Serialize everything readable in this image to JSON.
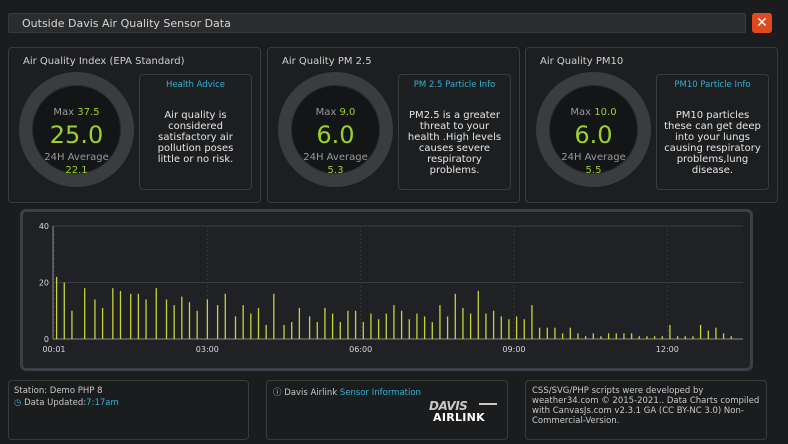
{
  "window": {
    "title": "Outside Davis Air Quality Sensor Data",
    "close_label": "✕"
  },
  "panels": [
    {
      "title": "Air Quality Index (EPA Standard)",
      "max_label": "Max",
      "max_value": "37.5",
      "value": "25.0",
      "avg_label": "24H Average",
      "avg_value": "22.1",
      "advice_title": "Health Advice",
      "advice_text": "Air quality is considered satisfactory air pollution poses little or no risk."
    },
    {
      "title": "Air Quality PM 2.5",
      "max_label": "Max",
      "max_value": "9.0",
      "value": "6.0",
      "avg_label": "24H Average",
      "avg_value": "5.3",
      "advice_title": "PM 2.5 Particle Info",
      "advice_text": "PM2.5 is a greater threat to your health .High levels causes severe respiratory problems."
    },
    {
      "title": "Air Quality PM10",
      "max_label": "Max",
      "max_value": "10.0",
      "value": "6.0",
      "avg_label": "24H Average",
      "avg_value": "5.5",
      "advice_title": "PM10 Particle Info",
      "advice_text": "PM10 particles these can get deep into your lungs causing respiratory problems,lung disease."
    }
  ],
  "chart_data": {
    "type": "bar",
    "ylim": [
      0,
      40
    ],
    "y_ticks": [
      "0",
      "20",
      "40"
    ],
    "x_ticks": [
      "00:01",
      "03:00",
      "06:00",
      "09:00",
      "12:00"
    ],
    "x_range_hours": [
      0,
      13.5
    ],
    "bar_color": "#c8d33c",
    "hours": [
      0.05,
      0.2,
      0.35,
      0.6,
      0.8,
      0.95,
      1.15,
      1.3,
      1.5,
      1.65,
      1.8,
      2.0,
      2.2,
      2.35,
      2.5,
      2.65,
      2.8,
      3.0,
      3.2,
      3.35,
      3.55,
      3.7,
      3.85,
      4.0,
      4.15,
      4.3,
      4.5,
      4.65,
      4.8,
      5.0,
      5.15,
      5.3,
      5.45,
      5.6,
      5.75,
      5.9,
      6.05,
      6.2,
      6.35,
      6.5,
      6.65,
      6.8,
      6.95,
      7.1,
      7.25,
      7.4,
      7.55,
      7.7,
      7.85,
      8.0,
      8.15,
      8.3,
      8.45,
      8.6,
      8.75,
      8.9,
      9.05,
      9.2,
      9.35,
      9.5,
      9.65,
      9.8,
      9.95,
      10.1,
      10.25,
      10.4,
      10.55,
      10.7,
      10.85,
      11.0,
      11.15,
      11.3,
      11.45,
      11.6,
      11.75,
      11.9,
      12.05,
      12.2,
      12.35,
      12.5,
      12.65,
      12.8,
      12.95,
      13.1,
      13.25
    ],
    "values": [
      22,
      20,
      10,
      18,
      14,
      11,
      18,
      17,
      16,
      16,
      14,
      18,
      14,
      12,
      15,
      13,
      10,
      14,
      12,
      16,
      8,
      12,
      9,
      11,
      5,
      16,
      5,
      6,
      11,
      8,
      6,
      11,
      9,
      6,
      10,
      10,
      6,
      9,
      7,
      9,
      12,
      10,
      7,
      9,
      8,
      6,
      12,
      8,
      16,
      11,
      9,
      17,
      9,
      10,
      8,
      7,
      8,
      7,
      12,
      4,
      4,
      4,
      2,
      4,
      2,
      1,
      2,
      1,
      2,
      2,
      2,
      2,
      1,
      1,
      1,
      1,
      5,
      1,
      1,
      1,
      5,
      3,
      4,
      2,
      1
    ],
    "title": "",
    "xlabel": "",
    "ylabel": ""
  },
  "footer": {
    "station_label": "Station: Demo PHP 8",
    "updated_label": "Data Updated:",
    "updated_time": "7:17am",
    "airlink_text": "Davis Airlink",
    "sensor_info": "Sensor Information",
    "logo_top": "DAVIS",
    "logo_bottom": "AIRLINK",
    "credits": "CSS/SVG/PHP scripts were developed by weather34.com © 2015-2021.. Data Charts compiled with CanvasJs.com v2.3.1 GA (CC BY-NC 3.0) Non-Commercial-Version."
  },
  "colors": {
    "accent": "#2fb3d6",
    "value_green": "#9bd12a",
    "close_red": "#e04a1f"
  }
}
